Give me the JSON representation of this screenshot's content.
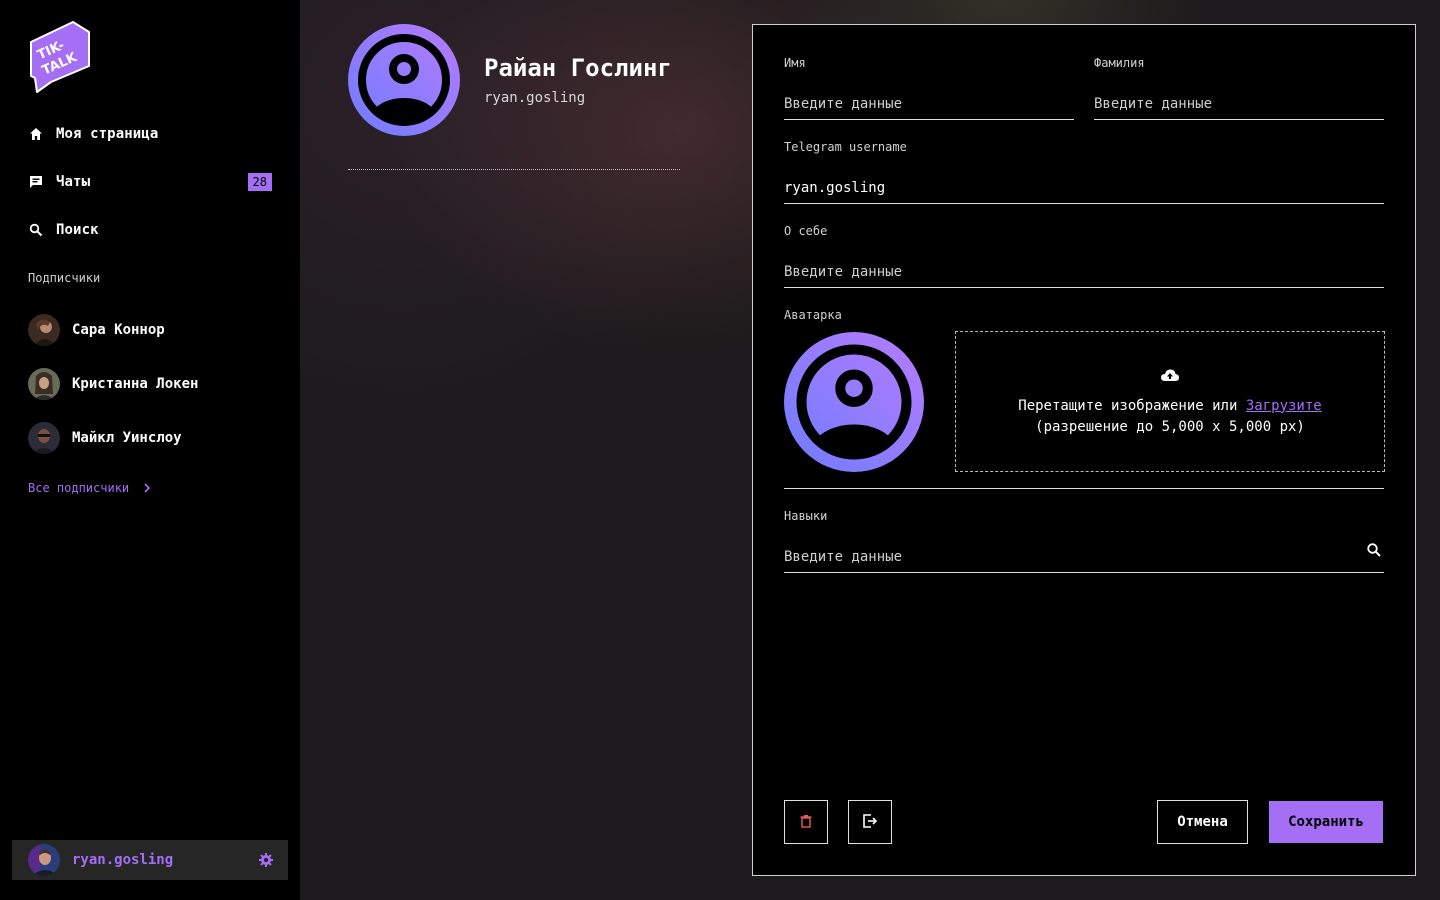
{
  "brand": {
    "logo_text": "TIK-TALK",
    "accent": "#a46ef5"
  },
  "sidebar": {
    "nav": [
      {
        "label": "Моя страница",
        "icon": "home-icon"
      },
      {
        "label": "Чаты",
        "icon": "chat-icon",
        "badge": "28"
      },
      {
        "label": "Поиск",
        "icon": "search-icon"
      }
    ],
    "subscribers_title": "Подписчики",
    "subscribers": [
      {
        "name": "Сара Коннор"
      },
      {
        "name": "Кристанна Локен"
      },
      {
        "name": "Майкл Уинслоу"
      }
    ],
    "all_subscribers_label": "Все подписчики",
    "current_user": {
      "username": "ryan.gosling"
    }
  },
  "profile": {
    "name": "Райан Гослинг",
    "username": "ryan.gosling"
  },
  "form": {
    "first_name": {
      "label": "Имя",
      "placeholder": "Введите данные",
      "value": ""
    },
    "last_name": {
      "label": "Фамилия",
      "placeholder": "Введите данные",
      "value": ""
    },
    "telegram": {
      "label": "Telegram username",
      "placeholder": "Введите данные",
      "value": "ryan.gosling"
    },
    "about": {
      "label": "О себе",
      "placeholder": "Введите данные",
      "value": ""
    },
    "avatar": {
      "label": "Аватарка",
      "drop_text": "Перетащите изображение или",
      "upload_link": "Загрузите",
      "resolution_note": "(разрешение до 5,000 x 5,000 px)"
    },
    "skills": {
      "label": "Навыки",
      "placeholder": "Введите данные",
      "value": ""
    }
  },
  "actions": {
    "cancel_label": "Отмена",
    "save_label": "Сохранить"
  }
}
